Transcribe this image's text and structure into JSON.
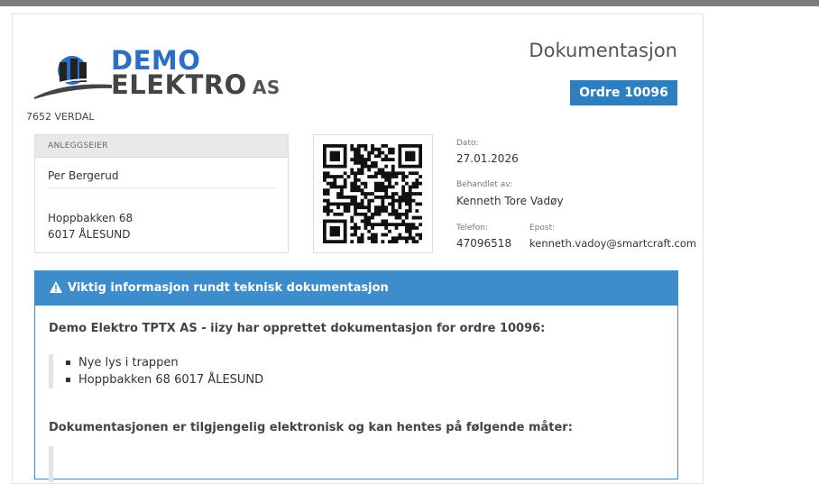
{
  "company": {
    "logo_line1": "DEMO",
    "logo_line2": "ELEKTRO",
    "logo_suffix": "AS",
    "address_line": "7652 VERDAL"
  },
  "header": {
    "title": "Dokumentasjon",
    "order_badge": "Ordre 10096"
  },
  "owner": {
    "heading": "ANLEGGSEIER",
    "name": "Per Bergerud",
    "street": "Hoppbakken 68",
    "city": "6017 ÅLESUND"
  },
  "meta": {
    "date_label": "Dato:",
    "date_value": "27.01.2026",
    "handled_label": "Behandlet av:",
    "handled_value": "Kenneth Tore Vadøy",
    "phone_label": "Telefon:",
    "phone_value": "47096518",
    "email_label": "Epost:",
    "email_value": "kenneth.vadoy@smartcraft.com"
  },
  "info_panel": {
    "heading": "Viktig informasjon rundt teknisk dokumentasjon",
    "intro": "Demo Elektro TPTX AS - iizy har opprettet dokumentasjon for ordre 10096:",
    "items": [
      "Nye lys i trappen",
      "Hoppbakken 68 6017 ÅLESUND"
    ],
    "availability": "Dokumentasjonen er tilgjengelig elektronisk og kan hentes på følgende måter:"
  },
  "colors": {
    "accent": "#2d7fbf",
    "panel": "#3d8ccb",
    "logo_blue": "#2a6fc1"
  }
}
